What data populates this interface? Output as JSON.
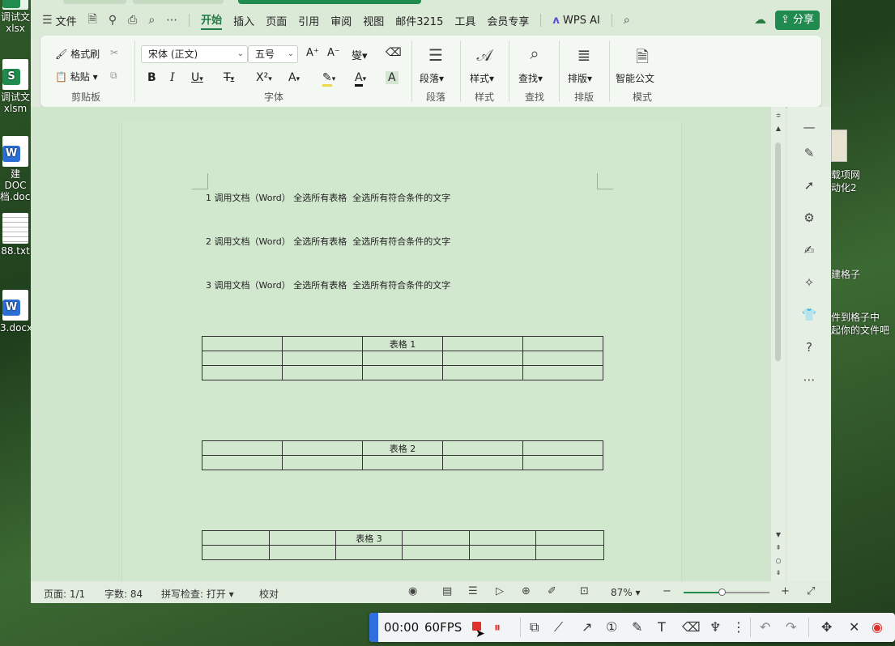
{
  "desktop": {
    "left_icons": [
      {
        "label_1": "调试文",
        "label_2": "xlsx",
        "badge": "",
        "badge_color": "#1f8b4e"
      },
      {
        "label_1": "调试文",
        "label_2": "xlsm",
        "badge": "S",
        "badge_color": "#1f8b4e"
      },
      {
        "label_1": "建DOC",
        "label_2": "档.docx",
        "badge": "W",
        "badge_color": "#2b6fd6"
      },
      {
        "label_1": "88.txt",
        "label_2": "",
        "badge": "",
        "badge_color": "#888888"
      },
      {
        "label_1": "3.docx",
        "label_2": "",
        "badge": "W",
        "badge_color": "#2b6fd6"
      }
    ],
    "right_labels": {
      "item1_line1": "载项网",
      "item1_line2": "动化2",
      "item2": "建格子",
      "item3_line1": "件到格子中",
      "item3_line2": "起你的文件吧"
    }
  },
  "menu": {
    "file": "文件",
    "tabs": [
      "开始",
      "插入",
      "页面",
      "引用",
      "审阅",
      "视图",
      "邮件3215",
      "工具",
      "会员专享"
    ],
    "active_tab": "开始",
    "wps_ai": "WPS AI",
    "share": "分享"
  },
  "ribbon": {
    "clipboard": {
      "format_painter": "格式刷",
      "paste": "粘贴",
      "label": "剪贴板"
    },
    "font": {
      "family": "宋体 (正文)",
      "size": "五号",
      "label": "字体"
    },
    "paragraph": {
      "button": "段落",
      "label": "段落"
    },
    "styles": {
      "button": "样式",
      "label": "样式"
    },
    "find": {
      "button": "查找",
      "label": "查找"
    },
    "layout": {
      "button": "排版",
      "label": "排版"
    },
    "mode": {
      "button": "智能公文",
      "label": "模式"
    }
  },
  "document": {
    "paragraphs": [
      "1 调用文档（Word） 全选所有表格  全选所有符合条件的文字",
      "2 调用文档（Word） 全选所有表格  全选所有符合条件的文字",
      "3 调用文档（Word） 全选所有表格  全选所有符合条件的文字"
    ],
    "table1_title": "表格 1",
    "table2_title": "表格 2",
    "table3_title": "表格 3"
  },
  "status": {
    "page": "页面: 1/1",
    "words": "字数: 84",
    "spell": "拼写检查: 打开",
    "proof": "校对",
    "zoom": "87%",
    "zoom_fraction": 0.44
  },
  "recorder": {
    "time": "00:00",
    "fps": "60FPS"
  }
}
